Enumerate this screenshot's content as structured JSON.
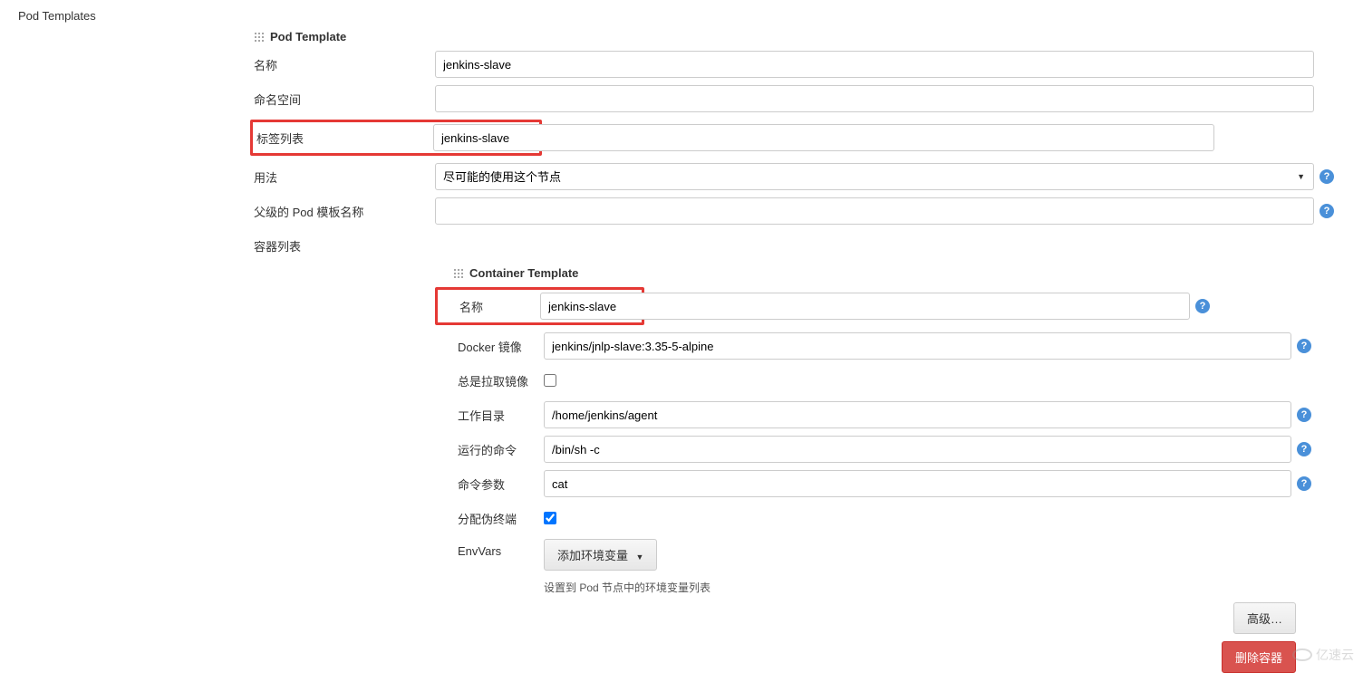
{
  "section": {
    "title": "Pod Templates"
  },
  "pod": {
    "header": "Pod Template",
    "name_label": "名称",
    "name_value": "jenkins-slave",
    "namespace_label": "命名空间",
    "namespace_value": "",
    "labels_label": "标签列表",
    "labels_value": "jenkins-slave",
    "usage_label": "用法",
    "usage_selected": "尽可能的使用这个节点",
    "parent_label": "父级的 Pod 模板名称",
    "parent_value": "",
    "containers_label": "容器列表"
  },
  "container": {
    "header": "Container Template",
    "name_label": "名称",
    "name_value": "jenkins-slave",
    "docker_label": "Docker 镜像",
    "docker_value": "jenkins/jnlp-slave:3.35-5-alpine",
    "always_pull_label": "总是拉取镜像",
    "always_pull_checked": false,
    "workdir_label": "工作目录",
    "workdir_value": "/home/jenkins/agent",
    "command_label": "运行的命令",
    "command_value": "/bin/sh -c",
    "args_label": "命令参数",
    "args_value": "cat",
    "tty_label": "分配伪终端",
    "tty_checked": true,
    "envvars_label": "EnvVars",
    "envvars_button": "添加环境变量",
    "envvars_hint": "设置到 Pod 节点中的环境变量列表"
  },
  "buttons": {
    "advanced": "高级…",
    "delete_container": "删除容器"
  },
  "watermark": "亿速云"
}
